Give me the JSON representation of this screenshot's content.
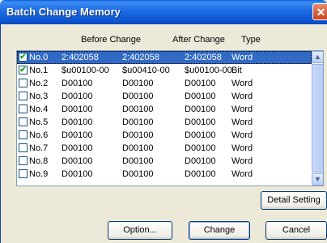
{
  "window": {
    "title": "Batch Change Memory",
    "close_glyph": "✕"
  },
  "columns": {
    "before": "Before Change",
    "after": "After Change",
    "type": "Type"
  },
  "rows": [
    {
      "checked": true,
      "no": "No.0",
      "before": "2:402058",
      "after": "2:402058",
      "current": "2:402058",
      "type": "Word",
      "selected": true
    },
    {
      "checked": true,
      "no": "No.1",
      "before": "$u00100-00",
      "after": "$u00410-00",
      "current": "$u00100-00",
      "type": "Bit",
      "selected": false
    },
    {
      "checked": false,
      "no": "No.2",
      "before": "D00100",
      "after": "D00100",
      "current": "D00100",
      "type": "Word",
      "selected": false
    },
    {
      "checked": false,
      "no": "No.3",
      "before": "D00100",
      "after": "D00100",
      "current": "D00100",
      "type": "Word",
      "selected": false
    },
    {
      "checked": false,
      "no": "No.4",
      "before": "D00100",
      "after": "D00100",
      "current": "D00100",
      "type": "Word",
      "selected": false
    },
    {
      "checked": false,
      "no": "No.5",
      "before": "D00100",
      "after": "D00100",
      "current": "D00100",
      "type": "Word",
      "selected": false
    },
    {
      "checked": false,
      "no": "No.6",
      "before": "D00100",
      "after": "D00100",
      "current": "D00100",
      "type": "Word",
      "selected": false
    },
    {
      "checked": false,
      "no": "No.7",
      "before": "D00100",
      "after": "D00100",
      "current": "D00100",
      "type": "Word",
      "selected": false
    },
    {
      "checked": false,
      "no": "No.8",
      "before": "D00100",
      "after": "D00100",
      "current": "D00100",
      "type": "Word",
      "selected": false
    },
    {
      "checked": false,
      "no": "No.9",
      "before": "D00100",
      "after": "D00100",
      "current": "D00100",
      "type": "Word",
      "selected": false
    }
  ],
  "buttons": {
    "detail": "Detail Setting",
    "option": "Option...",
    "change": "Change",
    "cancel": "Cancel"
  },
  "icons": {
    "scroll_up": "chevron-up-icon",
    "scroll_down": "chevron-down-icon"
  },
  "colors": {
    "title_bar": "#1f6fe6",
    "selection": "#316ac5",
    "dialog_bg": "#ece9d8"
  }
}
